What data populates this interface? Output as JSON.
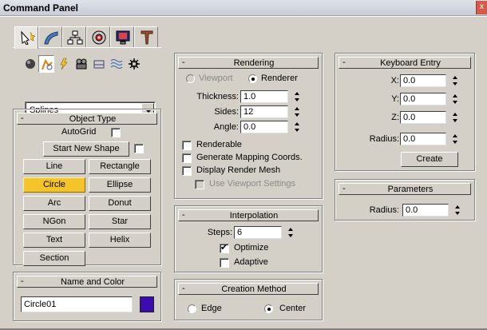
{
  "window": {
    "title": "Command Panel",
    "close_label": "x"
  },
  "tabs": [
    {
      "icon": "create-icon",
      "active": true
    },
    {
      "icon": "modify-icon"
    },
    {
      "icon": "hierarchy-icon"
    },
    {
      "icon": "motion-icon"
    },
    {
      "icon": "display-icon"
    },
    {
      "icon": "utilities-icon"
    }
  ],
  "subcategories": [
    "geometry-icon",
    "shapes-icon",
    "lights-icon",
    "cameras-icon",
    "helpers-icon",
    "space-warps-icon",
    "systems-icon"
  ],
  "category_dropdown": {
    "value": "Splines"
  },
  "object_type": {
    "title": "Object Type",
    "autogrid_label": "AutoGrid",
    "start_new_shape_label": "Start New Shape",
    "buttons": [
      "Line",
      "Rectangle",
      "Circle",
      "Ellipse",
      "Arc",
      "Donut",
      "NGon",
      "Star",
      "Text",
      "Helix",
      "Section"
    ],
    "active_button": "Circle"
  },
  "name_color": {
    "title": "Name and Color",
    "name": "Circle01",
    "color": "#3c0cb0"
  },
  "rendering": {
    "title": "Rendering",
    "viewport_label": "Viewport",
    "renderer_label": "Renderer",
    "thickness_label": "Thickness:",
    "thickness": "1.0",
    "sides_label": "Sides:",
    "sides": "12",
    "angle_label": "Angle:",
    "angle": "0.0",
    "renderable_label": "Renderable",
    "gen_mapping_label": "Generate Mapping Coords.",
    "display_render_mesh_label": "Display Render Mesh",
    "use_viewport_label": "Use Viewport Settings"
  },
  "interpolation": {
    "title": "Interpolation",
    "steps_label": "Steps:",
    "steps": "6",
    "optimize_label": "Optimize",
    "adaptive_label": "Adaptive"
  },
  "creation_method": {
    "title": "Creation Method",
    "edge_label": "Edge",
    "center_label": "Center"
  },
  "keyboard_entry": {
    "title": "Keyboard Entry",
    "x_label": "X:",
    "x": "0.0",
    "y_label": "Y:",
    "y": "0.0",
    "z_label": "Z:",
    "z": "0.0",
    "radius_label": "Radius:",
    "radius": "0.0",
    "create_label": "Create"
  },
  "parameters": {
    "title": "Parameters",
    "radius_label": "Radius:",
    "radius": "0.0"
  }
}
